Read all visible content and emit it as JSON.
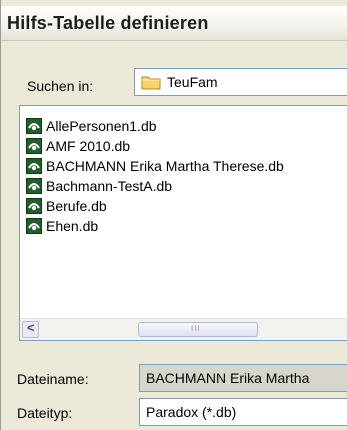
{
  "window": {
    "title": "Hilfs-Tabelle definieren"
  },
  "lookin": {
    "label": "Suchen in:",
    "value": "TeuFam",
    "icon": "folder-icon"
  },
  "files": [
    {
      "name": "AllePersonen1.db",
      "icon": "paradox-db-icon"
    },
    {
      "name": "AMF 2010.db",
      "icon": "paradox-db-icon"
    },
    {
      "name": "BACHMANN Erika Martha Therese.db",
      "icon": "paradox-db-icon"
    },
    {
      "name": "Bachmann-TestA.db",
      "icon": "paradox-db-icon"
    },
    {
      "name": "Berufe.db",
      "icon": "paradox-db-icon"
    },
    {
      "name": "Ehen.db",
      "icon": "paradox-db-icon"
    }
  ],
  "scrollbar": {
    "left_arrow": "<",
    "thumb_grip": "III"
  },
  "filename": {
    "label": "Dateiname:",
    "value": "BACHMANN Erika Martha"
  },
  "filetype": {
    "label": "Dateityp:",
    "value": "Paradox (*.db)"
  }
}
